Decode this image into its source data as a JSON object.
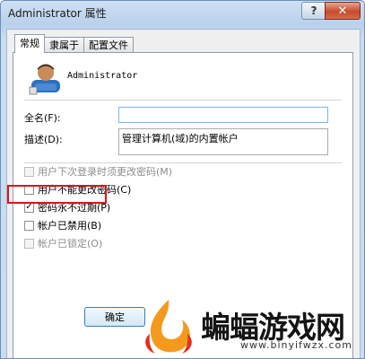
{
  "window": {
    "title": "Administrator 属性",
    "help_label": "?",
    "close_label": "✕"
  },
  "tabs": [
    {
      "label": "常规",
      "active": true
    },
    {
      "label": "隶属于",
      "active": false
    },
    {
      "label": "配置文件",
      "active": false
    }
  ],
  "general": {
    "username": "Administrator",
    "fullname_label": "全名(F):",
    "fullname_value": "",
    "description_label": "描述(D):",
    "description_value": "管理计算机(域)的内置帐户"
  },
  "options": [
    {
      "label": "用户下次登录时须更改密码(M)",
      "checked": false,
      "enabled": false
    },
    {
      "label": "用户不能更改密码(C)",
      "checked": false,
      "enabled": true
    },
    {
      "label": "密码永不过期(P)",
      "checked": true,
      "enabled": true
    },
    {
      "label": "帐户已禁用(B)",
      "checked": false,
      "enabled": true,
      "highlighted": true
    },
    {
      "label": "帐户已锁定(O)",
      "checked": false,
      "enabled": false
    }
  ],
  "buttons": {
    "ok_label": "确定"
  },
  "watermark": {
    "name": "蝙蝠游戏网",
    "url": "www.binyifwzx.com"
  },
  "colors": {
    "highlight_border": "#d8171d",
    "close_button": "#c74a2d"
  }
}
